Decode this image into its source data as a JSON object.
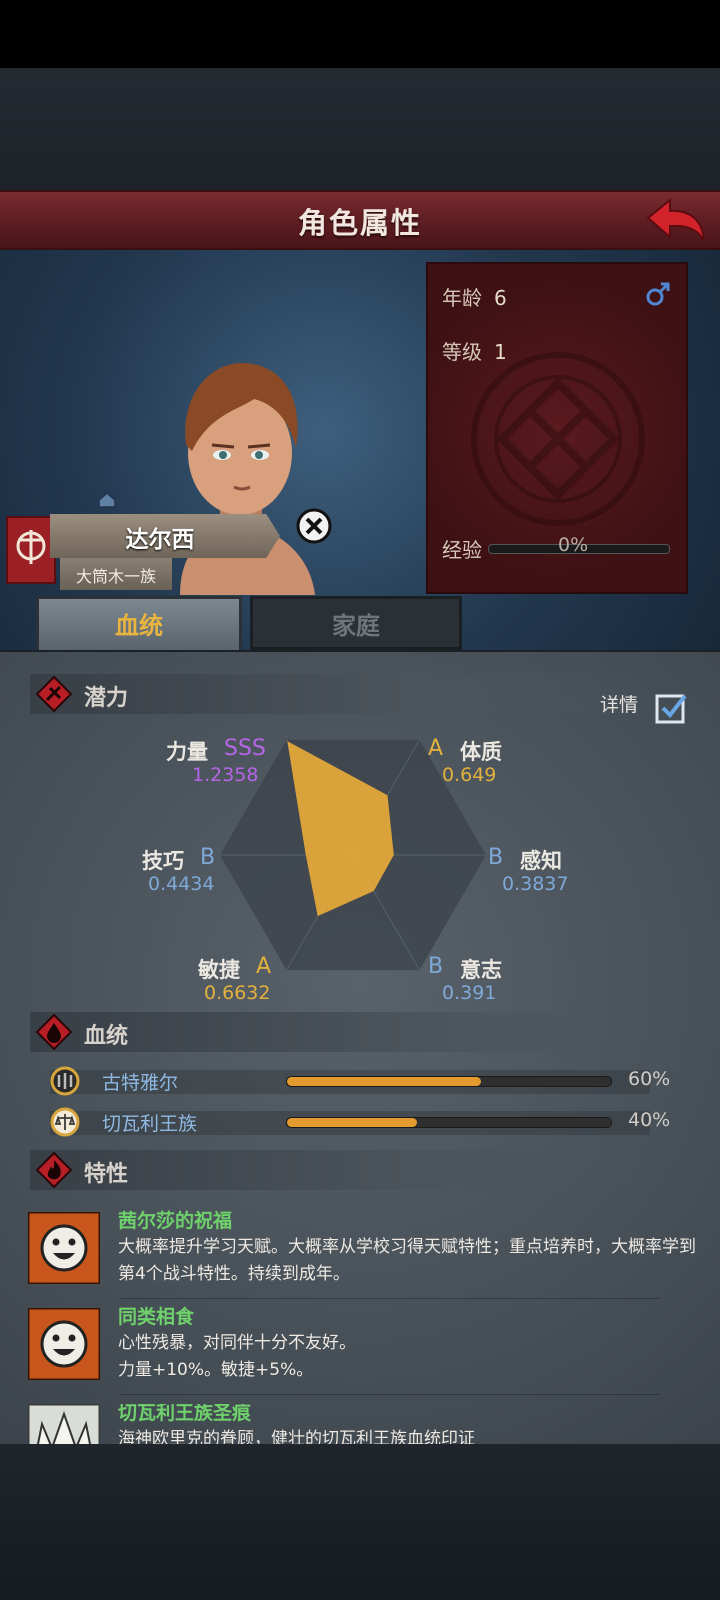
{
  "header": {
    "title": "角色属性"
  },
  "character": {
    "name": "达尔西",
    "clan": "大筒木一族",
    "age_label": "年龄",
    "age": "6",
    "level_label": "等级",
    "level": "1",
    "exp_label": "经验",
    "exp_value": "0%",
    "exp_fraction": 0
  },
  "tabs": [
    {
      "label": "血统",
      "active": true
    },
    {
      "label": "家庭",
      "active": false
    }
  ],
  "potential": {
    "section_label": "潜力",
    "detail_label": "详情",
    "detail_checked": true,
    "stats": [
      {
        "label": "力量",
        "grade": "SSS",
        "value": "1.2358",
        "color": "#b765e8"
      },
      {
        "label": "体质",
        "grade": "A",
        "value": "0.649",
        "color": "#e3b13d"
      },
      {
        "label": "感知",
        "grade": "B",
        "value": "0.3837",
        "color": "#7ea9d8"
      },
      {
        "label": "意志",
        "grade": "B",
        "value": "0.391",
        "color": "#7ea9d8"
      },
      {
        "label": "敏捷",
        "grade": "A",
        "value": "0.6632",
        "color": "#e3b13d"
      },
      {
        "label": "技巧",
        "grade": "B",
        "value": "0.4434",
        "color": "#7ea9d8"
      }
    ]
  },
  "bloodline": {
    "section_label": "血统",
    "items": [
      {
        "name": "古特雅尔",
        "percent": "60%",
        "fraction": 0.6
      },
      {
        "name": "切瓦利王族",
        "percent": "40%",
        "fraction": 0.4
      }
    ]
  },
  "traits": {
    "section_label": "特性",
    "items": [
      {
        "name": "茜尔莎的祝福",
        "desc": "大概率提升学习天赋。大概率从学校习得天赋特性；重点培养时，大概率学到第4个战斗特性。持续到成年。"
      },
      {
        "name": "同类相食",
        "desc": "心性残暴，对同伴十分不友好。",
        "desc2": "力量+10%。敏捷+5%。"
      },
      {
        "name": "切瓦利王族圣痕",
        "desc": "海神欧里克的眷顾，健壮的切瓦利王族血统印证"
      }
    ]
  },
  "colors": {
    "accent": "#e9b53f",
    "radar_fill": "#e3a83a",
    "trait_name": "#6fd16b",
    "bloodline_label": "#8fb9e4"
  }
}
